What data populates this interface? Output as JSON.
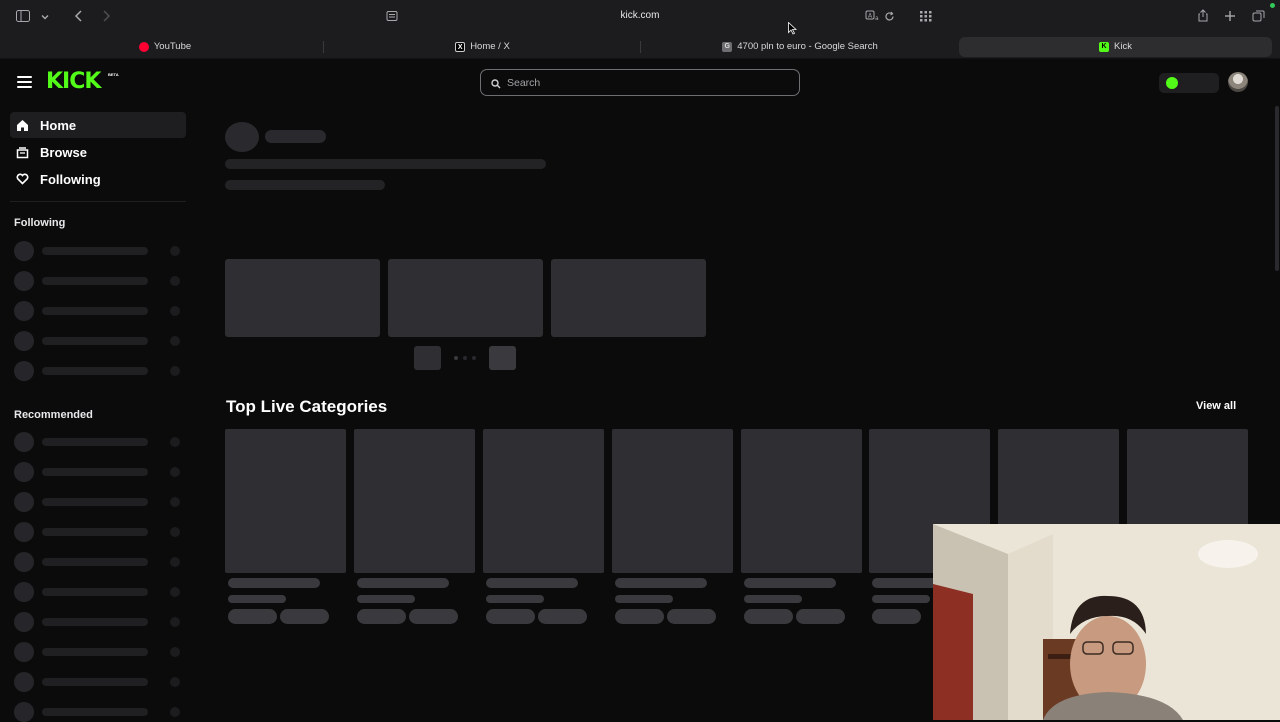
{
  "browser": {
    "url": "kick.com",
    "tabs": [
      {
        "label": "YouTube",
        "favicon_color": "#ff0033"
      },
      {
        "label": "Home / X",
        "favicon_color": "#000000"
      },
      {
        "label": "4700 pln to euro - Google Search",
        "favicon_color": "#6e6e72"
      },
      {
        "label": "Kick",
        "favicon_color": "#53fc18",
        "active": true
      }
    ]
  },
  "header": {
    "logo": "KICK",
    "logo_badge": "BETA",
    "search_placeholder": "Search",
    "brand_color": "#53fc18"
  },
  "sidebar": {
    "nav": [
      {
        "label": "Home",
        "icon": "home-icon",
        "active": true
      },
      {
        "label": "Browse",
        "icon": "browse-icon"
      },
      {
        "label": "Following",
        "icon": "heart-icon"
      }
    ],
    "following_title": "Following",
    "recommended_title": "Recommended"
  },
  "main": {
    "top_live_categories_title": "Top Live Categories",
    "view_all_label": "View all"
  }
}
